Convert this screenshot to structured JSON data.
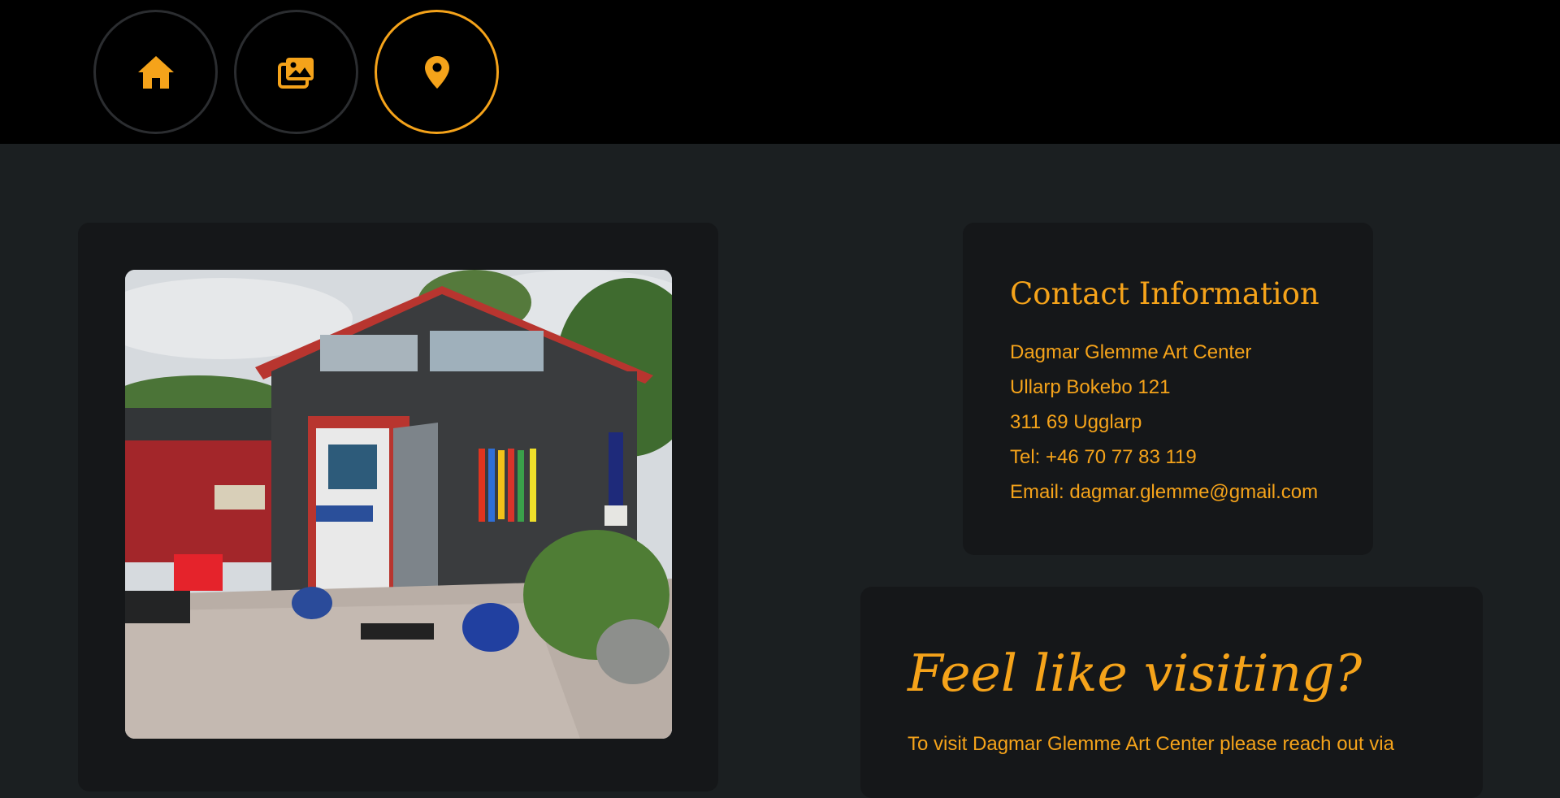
{
  "nav": {
    "items": [
      {
        "icon": "home-icon",
        "active": false
      },
      {
        "icon": "gallery-icon",
        "active": false
      },
      {
        "icon": "location-pin-icon",
        "active": true
      }
    ]
  },
  "colors": {
    "accent": "#f5a31a",
    "topbar": "#000000",
    "page_bg": "#1b1f21",
    "card_bg": "#151719"
  },
  "photo": {
    "subject": "art-studio-building-photo"
  },
  "contact": {
    "title": "Contact Information",
    "lines": [
      "Dagmar Glemme Art Center",
      "Ullarp Bokebo 121",
      "311 69 Ugglarp",
      "Tel: +46 70 77 83 119",
      "Email: dagmar.glemme@gmail.com"
    ]
  },
  "visit": {
    "title": "Feel like visiting?",
    "text": "To visit Dagmar Glemme Art Center please reach out via"
  }
}
